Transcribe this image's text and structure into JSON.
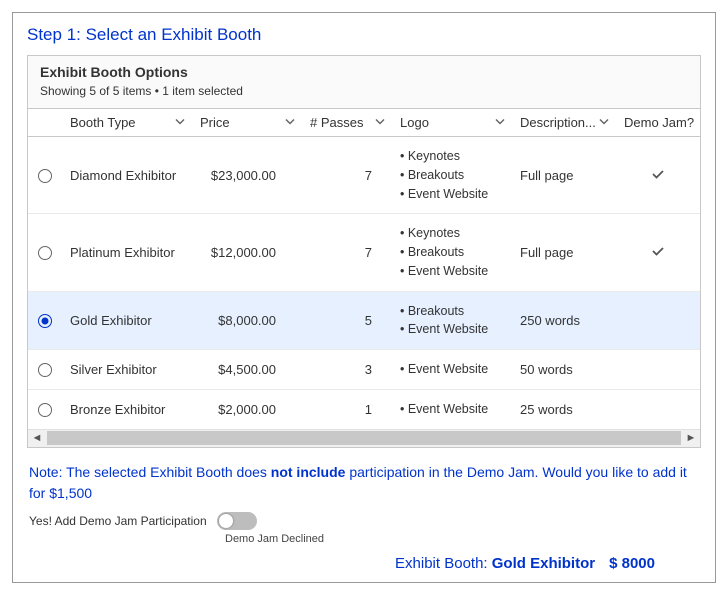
{
  "step_title": "Step 1: Select an Exhibit Booth",
  "panel": {
    "title": "Exhibit Booth Options",
    "subtitle": "Showing 5 of 5 items • 1 item selected"
  },
  "columns": {
    "booth_type": "Booth Type",
    "price": "Price",
    "passes": "# Passes",
    "logo": "Logo",
    "description": "Description...",
    "demo_jam": "Demo Jam?"
  },
  "rows": [
    {
      "selected": false,
      "booth_type": "Diamond Exhibitor",
      "price": "$23,000.00",
      "passes": "7",
      "logo": [
        "Keynotes",
        "Breakouts",
        "Event Website"
      ],
      "description": "Full page",
      "demo_jam": true
    },
    {
      "selected": false,
      "booth_type": "Platinum Exhibitor",
      "price": "$12,000.00",
      "passes": "7",
      "logo": [
        "Keynotes",
        "Breakouts",
        "Event Website"
      ],
      "description": "Full page",
      "demo_jam": true
    },
    {
      "selected": true,
      "booth_type": "Gold Exhibitor",
      "price": "$8,000.00",
      "passes": "5",
      "logo": [
        "Breakouts",
        "Event Website"
      ],
      "description": "250 words",
      "demo_jam": false
    },
    {
      "selected": false,
      "booth_type": "Silver Exhibitor",
      "price": "$4,500.00",
      "passes": "3",
      "logo": [
        "Event Website"
      ],
      "description": "50 words",
      "demo_jam": false
    },
    {
      "selected": false,
      "booth_type": "Bronze Exhibitor",
      "price": "$2,000.00",
      "passes": "1",
      "logo": [
        "Event Website"
      ],
      "description": "25 words",
      "demo_jam": false
    }
  ],
  "note": {
    "prefix": "Note: The selected Exhibit Booth does ",
    "bold": "not include",
    "suffix": " participation in the Demo Jam. Would you like to add it for $1,500"
  },
  "toggle": {
    "label": "Yes! Add Demo Jam Participation",
    "sub": "Demo Jam Declined",
    "on": false
  },
  "footer": {
    "label": "Exhibit Booth: ",
    "value": "Gold Exhibitor",
    "amount": "$ 8000"
  }
}
